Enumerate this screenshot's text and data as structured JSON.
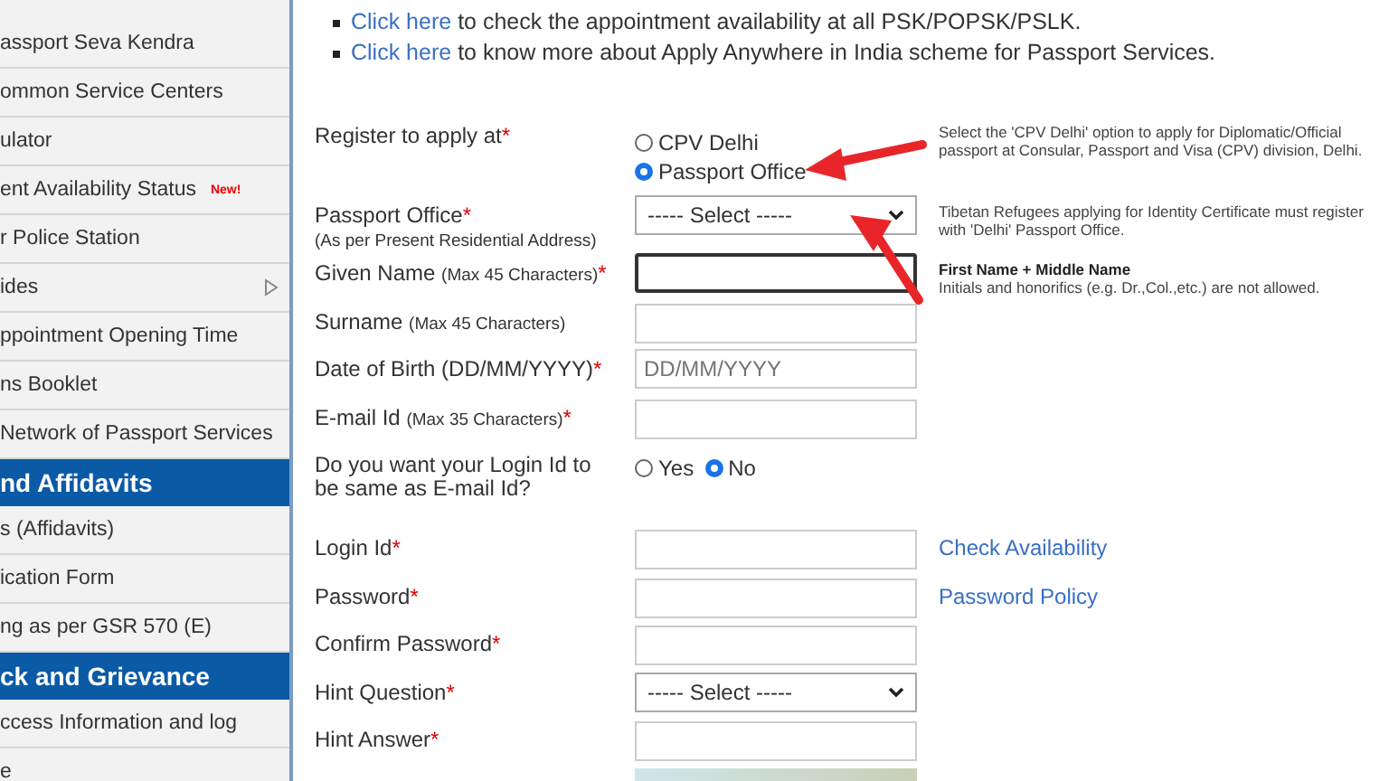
{
  "sidebar": {
    "items": [
      {
        "kind": "item",
        "label": "assport Seva Kendra"
      },
      {
        "kind": "item",
        "label": "ommon Service Centers"
      },
      {
        "kind": "item",
        "label": "ulator"
      },
      {
        "kind": "item",
        "label": "ent Availability Status",
        "badge": "New!"
      },
      {
        "kind": "item",
        "label": "r Police Station"
      },
      {
        "kind": "item",
        "label": "ides",
        "submenu": true
      },
      {
        "kind": "item",
        "label": "ppointment Opening Time"
      },
      {
        "kind": "item",
        "label": "ns Booklet"
      },
      {
        "kind": "item",
        "label": "Network of Passport Services"
      },
      {
        "kind": "header",
        "label": "nd Affidavits"
      },
      {
        "kind": "item",
        "label": "s (Affidavits)"
      },
      {
        "kind": "item",
        "label": "ication Form"
      },
      {
        "kind": "item",
        "label": "ng as per GSR 570 (E)"
      },
      {
        "kind": "header",
        "label": "ck and Grievance"
      },
      {
        "kind": "item",
        "label": "ccess Information and log"
      },
      {
        "kind": "item",
        "label": "e"
      }
    ]
  },
  "notices": [
    {
      "link": "Click here",
      "text": "to check the appointment availability at all PSK/POPSK/PSLK."
    },
    {
      "link": "Click here",
      "text": "to know more about Apply Anywhere in India scheme for Passport Services."
    }
  ],
  "form": {
    "rows": [
      {
        "kind": "radio",
        "label": "Register to apply at",
        "mark": "*",
        "options": [
          {
            "label": "CPV Delhi",
            "selected": false
          },
          {
            "label": "Passport Office",
            "selected": true
          }
        ],
        "help": "Select the 'CPV Delhi' option to apply for Diplomatic/Official passport at Consular, Passport and Visa (CPV) division, Delhi."
      },
      {
        "kind": "select",
        "label": "Passport Office",
        "mark": "*",
        "sublabel": "(As per Present Residential Address)",
        "value": "----- Select -----",
        "help": "Tibetan Refugees applying for Identity Certificate must register with 'Delhi' Passport Office."
      },
      {
        "kind": "text",
        "label": "Given Name",
        "note": "(Max 45 Characters)",
        "mark": "*",
        "focused": true,
        "help_title": "First Name + Middle Name",
        "help": "Initials and honorifics (e.g. Dr.,Col.,etc.) are not allowed."
      },
      {
        "kind": "text",
        "label": "Surname",
        "note": "(Max 45 Characters)"
      },
      {
        "kind": "date",
        "label": "Date of Birth (DD/MM/YYYY)",
        "mark": "*",
        "placeholder": "DD/MM/YYYY"
      },
      {
        "kind": "text",
        "label": "E-mail Id",
        "note": "(Max 35 Characters)",
        "mark": "*"
      },
      {
        "kind": "inline-radio",
        "label": "Do you want your Login Id to be same as E-mail Id?",
        "options": [
          {
            "label": "Yes",
            "selected": false
          },
          {
            "label": "No",
            "selected": true
          }
        ]
      },
      {
        "kind": "text",
        "label": "Login Id",
        "mark": "*",
        "link": "Check Availability"
      },
      {
        "kind": "text",
        "label": "Password",
        "mark": "*",
        "link": "Password Policy"
      },
      {
        "kind": "text",
        "label": "Confirm Password",
        "mark": "*"
      },
      {
        "kind": "select",
        "label": "Hint Question",
        "mark": "*",
        "value": "----- Select -----"
      },
      {
        "kind": "text",
        "label": "Hint Answer",
        "mark": "*"
      },
      {
        "kind": "image"
      }
    ]
  }
}
